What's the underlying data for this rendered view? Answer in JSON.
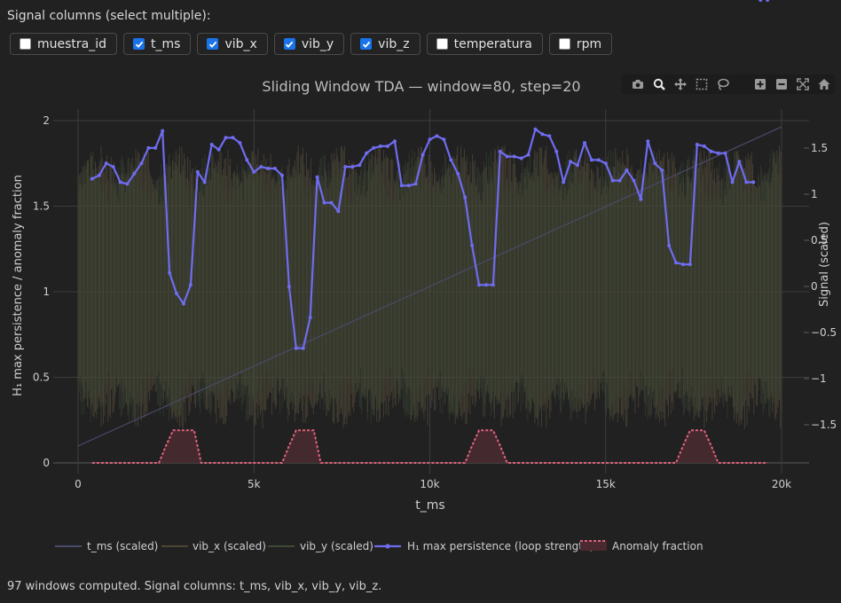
{
  "controls": {
    "label": "Signal columns (select multiple):",
    "options": [
      {
        "label": "muestra_id",
        "checked": false
      },
      {
        "label": "t_ms",
        "checked": true
      },
      {
        "label": "vib_x",
        "checked": true
      },
      {
        "label": "vib_y",
        "checked": true
      },
      {
        "label": "vib_z",
        "checked": true
      },
      {
        "label": "temperatura",
        "checked": false
      },
      {
        "label": "rpm",
        "checked": false
      }
    ]
  },
  "modebar": [
    "camera-icon",
    "zoom-icon",
    "pan-icon",
    "box-select-icon",
    "lasso-icon",
    "zoom-in-icon",
    "zoom-out-icon",
    "autoscale-icon",
    "reset-icon"
  ],
  "colors": {
    "persistence": "#6f6cf0",
    "anomaly": "#e0627a",
    "anomaly_fill": "#4a2a30",
    "signal": "#4c4536",
    "signal_alt": "#3e4a36"
  },
  "chart_data": {
    "type": "line",
    "title": "Sliding Window TDA — window=80, step=20",
    "xlabel": "t_ms",
    "ylabel": "H₁ max persistence / anomaly fraction",
    "y2label": "Signal (scaled)",
    "xlim": [
      -400,
      20500
    ],
    "ylim": [
      -0.06,
      2.05
    ],
    "y2lim": [
      -1.92,
      1.93
    ],
    "xticks": [
      0,
      5000,
      10000,
      15000,
      20000
    ],
    "xtick_labels": [
      "0",
      "5k",
      "10k",
      "15k",
      "20k"
    ],
    "yticks": [
      0,
      0.5,
      1,
      1.5,
      2
    ],
    "ytick_labels": [
      "0",
      "0.5",
      "1",
      "1.5",
      "2"
    ],
    "y2ticks": [
      -1.5,
      -1,
      -0.5,
      0,
      0.5,
      1,
      1.5
    ],
    "y2tick_labels": [
      "−1.5",
      "−1",
      "−0.5",
      "0",
      "0.5",
      "1",
      "1.5"
    ],
    "grid": true,
    "legend_position": "bottom",
    "legend": [
      "t_ms (scaled)",
      "vib_x (scaled)",
      "vib_y (scaled)",
      "H₁ max persistence (loop strength)",
      "Anomaly fraction"
    ],
    "t_ms_scaled": {
      "x": [
        0,
        20000
      ],
      "y": [
        -1.73,
        1.73
      ]
    },
    "persistence": {
      "x": [
        400,
        600,
        800,
        1000,
        1200,
        1400,
        1600,
        1800,
        2000,
        2200,
        2400,
        2600,
        2800,
        3000,
        3200,
        3400,
        3600,
        3800,
        4000,
        4200,
        4400,
        4600,
        4800,
        5000,
        5200,
        5400,
        5600,
        5800,
        6000,
        6200,
        6400,
        6600,
        6800,
        7000,
        7200,
        7400,
        7600,
        7800,
        8000,
        8200,
        8400,
        8600,
        8800,
        9000,
        9200,
        9400,
        9600,
        9800,
        10000,
        10200,
        10400,
        10600,
        10800,
        11000,
        11200,
        11400,
        11600,
        11800,
        12000,
        12200,
        12400,
        12600,
        12800,
        13000,
        13200,
        13400,
        13600,
        13800,
        14000,
        14200,
        14400,
        14600,
        14800,
        15000,
        15200,
        15400,
        15600,
        15800,
        16000,
        16200,
        16400,
        16600,
        16800,
        17000,
        17200,
        17400,
        17600,
        17800,
        18000,
        18200,
        18400,
        18600,
        18800,
        19000,
        19200,
        19400,
        19600
      ],
      "y": [
        1.66,
        1.68,
        1.75,
        1.73,
        1.64,
        1.63,
        1.69,
        1.75,
        1.84,
        1.84,
        1.94,
        1.11,
        0.99,
        0.93,
        1.04,
        1.7,
        1.64,
        1.86,
        1.83,
        1.9,
        1.9,
        1.87,
        1.77,
        1.7,
        1.73,
        1.72,
        1.72,
        1.68,
        1.03,
        0.67,
        0.67,
        0.85,
        1.67,
        1.52,
        1.52,
        1.47,
        1.73,
        1.73,
        1.74,
        1.81,
        1.84,
        1.85,
        1.85,
        1.88,
        1.62,
        1.62,
        1.63,
        1.8,
        1.89,
        1.91,
        1.89,
        1.77,
        1.69,
        1.55,
        1.27,
        1.04,
        1.04,
        1.04,
        1.82,
        1.79,
        1.79,
        1.78,
        1.8,
        1.95,
        1.92,
        1.91,
        1.82,
        1.64,
        1.76,
        1.74,
        1.87,
        1.77,
        1.77,
        1.75,
        1.65,
        1.65,
        1.71,
        1.65,
        1.54,
        1.88,
        1.75,
        1.71,
        1.27,
        1.17,
        1.16,
        1.16,
        1.86,
        1.85,
        1.82,
        1.81,
        1.81,
        1.64,
        1.76,
        1.64,
        1.64
      ],
      "color": "#6f6cf0"
    },
    "anomaly_fraction": {
      "x": [
        400,
        2300,
        2500,
        2700,
        3300,
        3500,
        5800,
        6000,
        6200,
        6700,
        6900,
        11000,
        11200,
        11400,
        11800,
        12000,
        12200,
        17000,
        17200,
        17400,
        17800,
        18000,
        18200,
        19600
      ],
      "y": [
        0,
        0,
        0.1,
        0.19,
        0.19,
        0,
        0,
        0.1,
        0.19,
        0.19,
        0,
        0,
        0.1,
        0.19,
        0.19,
        0.1,
        0,
        0,
        0.1,
        0.19,
        0.19,
        0.1,
        0,
        0
      ]
    }
  },
  "footer": "97 windows computed. Signal columns: t_ms, vib_x, vib_y, vib_z."
}
